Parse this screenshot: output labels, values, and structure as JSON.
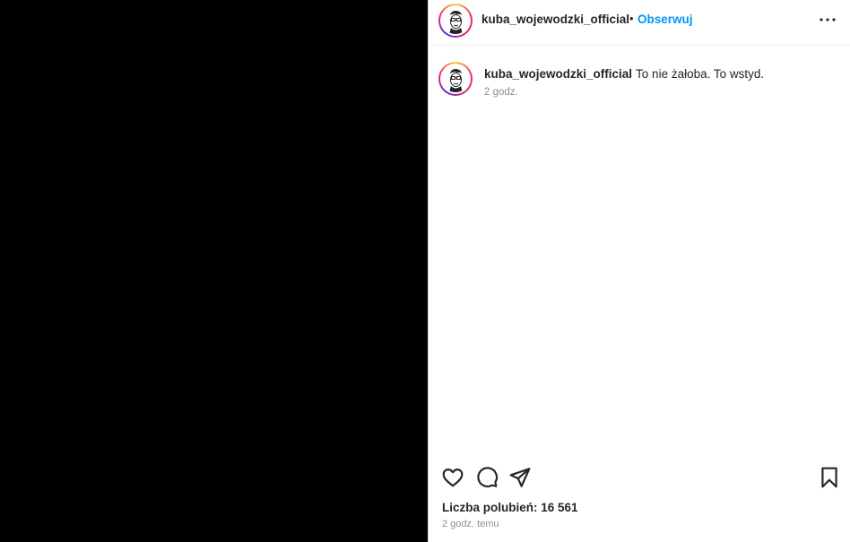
{
  "post": {
    "username": "kuba_wojewodzki_official",
    "follow_label": "Obserwuj",
    "separator": "•",
    "avatar_icon": "face-sketch-icon"
  },
  "caption": {
    "username": "kuba_wojewodzki_official",
    "text": "To nie żałoba. To wstyd.",
    "time": "2 godz."
  },
  "actions": {
    "icons": [
      "heart-icon",
      "comment-icon",
      "share-icon",
      "bookmark-icon"
    ]
  },
  "likes_label": "Liczba polubień: 16 561",
  "time_ago": "2 godz. temu",
  "colors": {
    "accent": "#0095f6",
    "media_background": "#000000",
    "secondary_text": "#8e8e8e"
  }
}
